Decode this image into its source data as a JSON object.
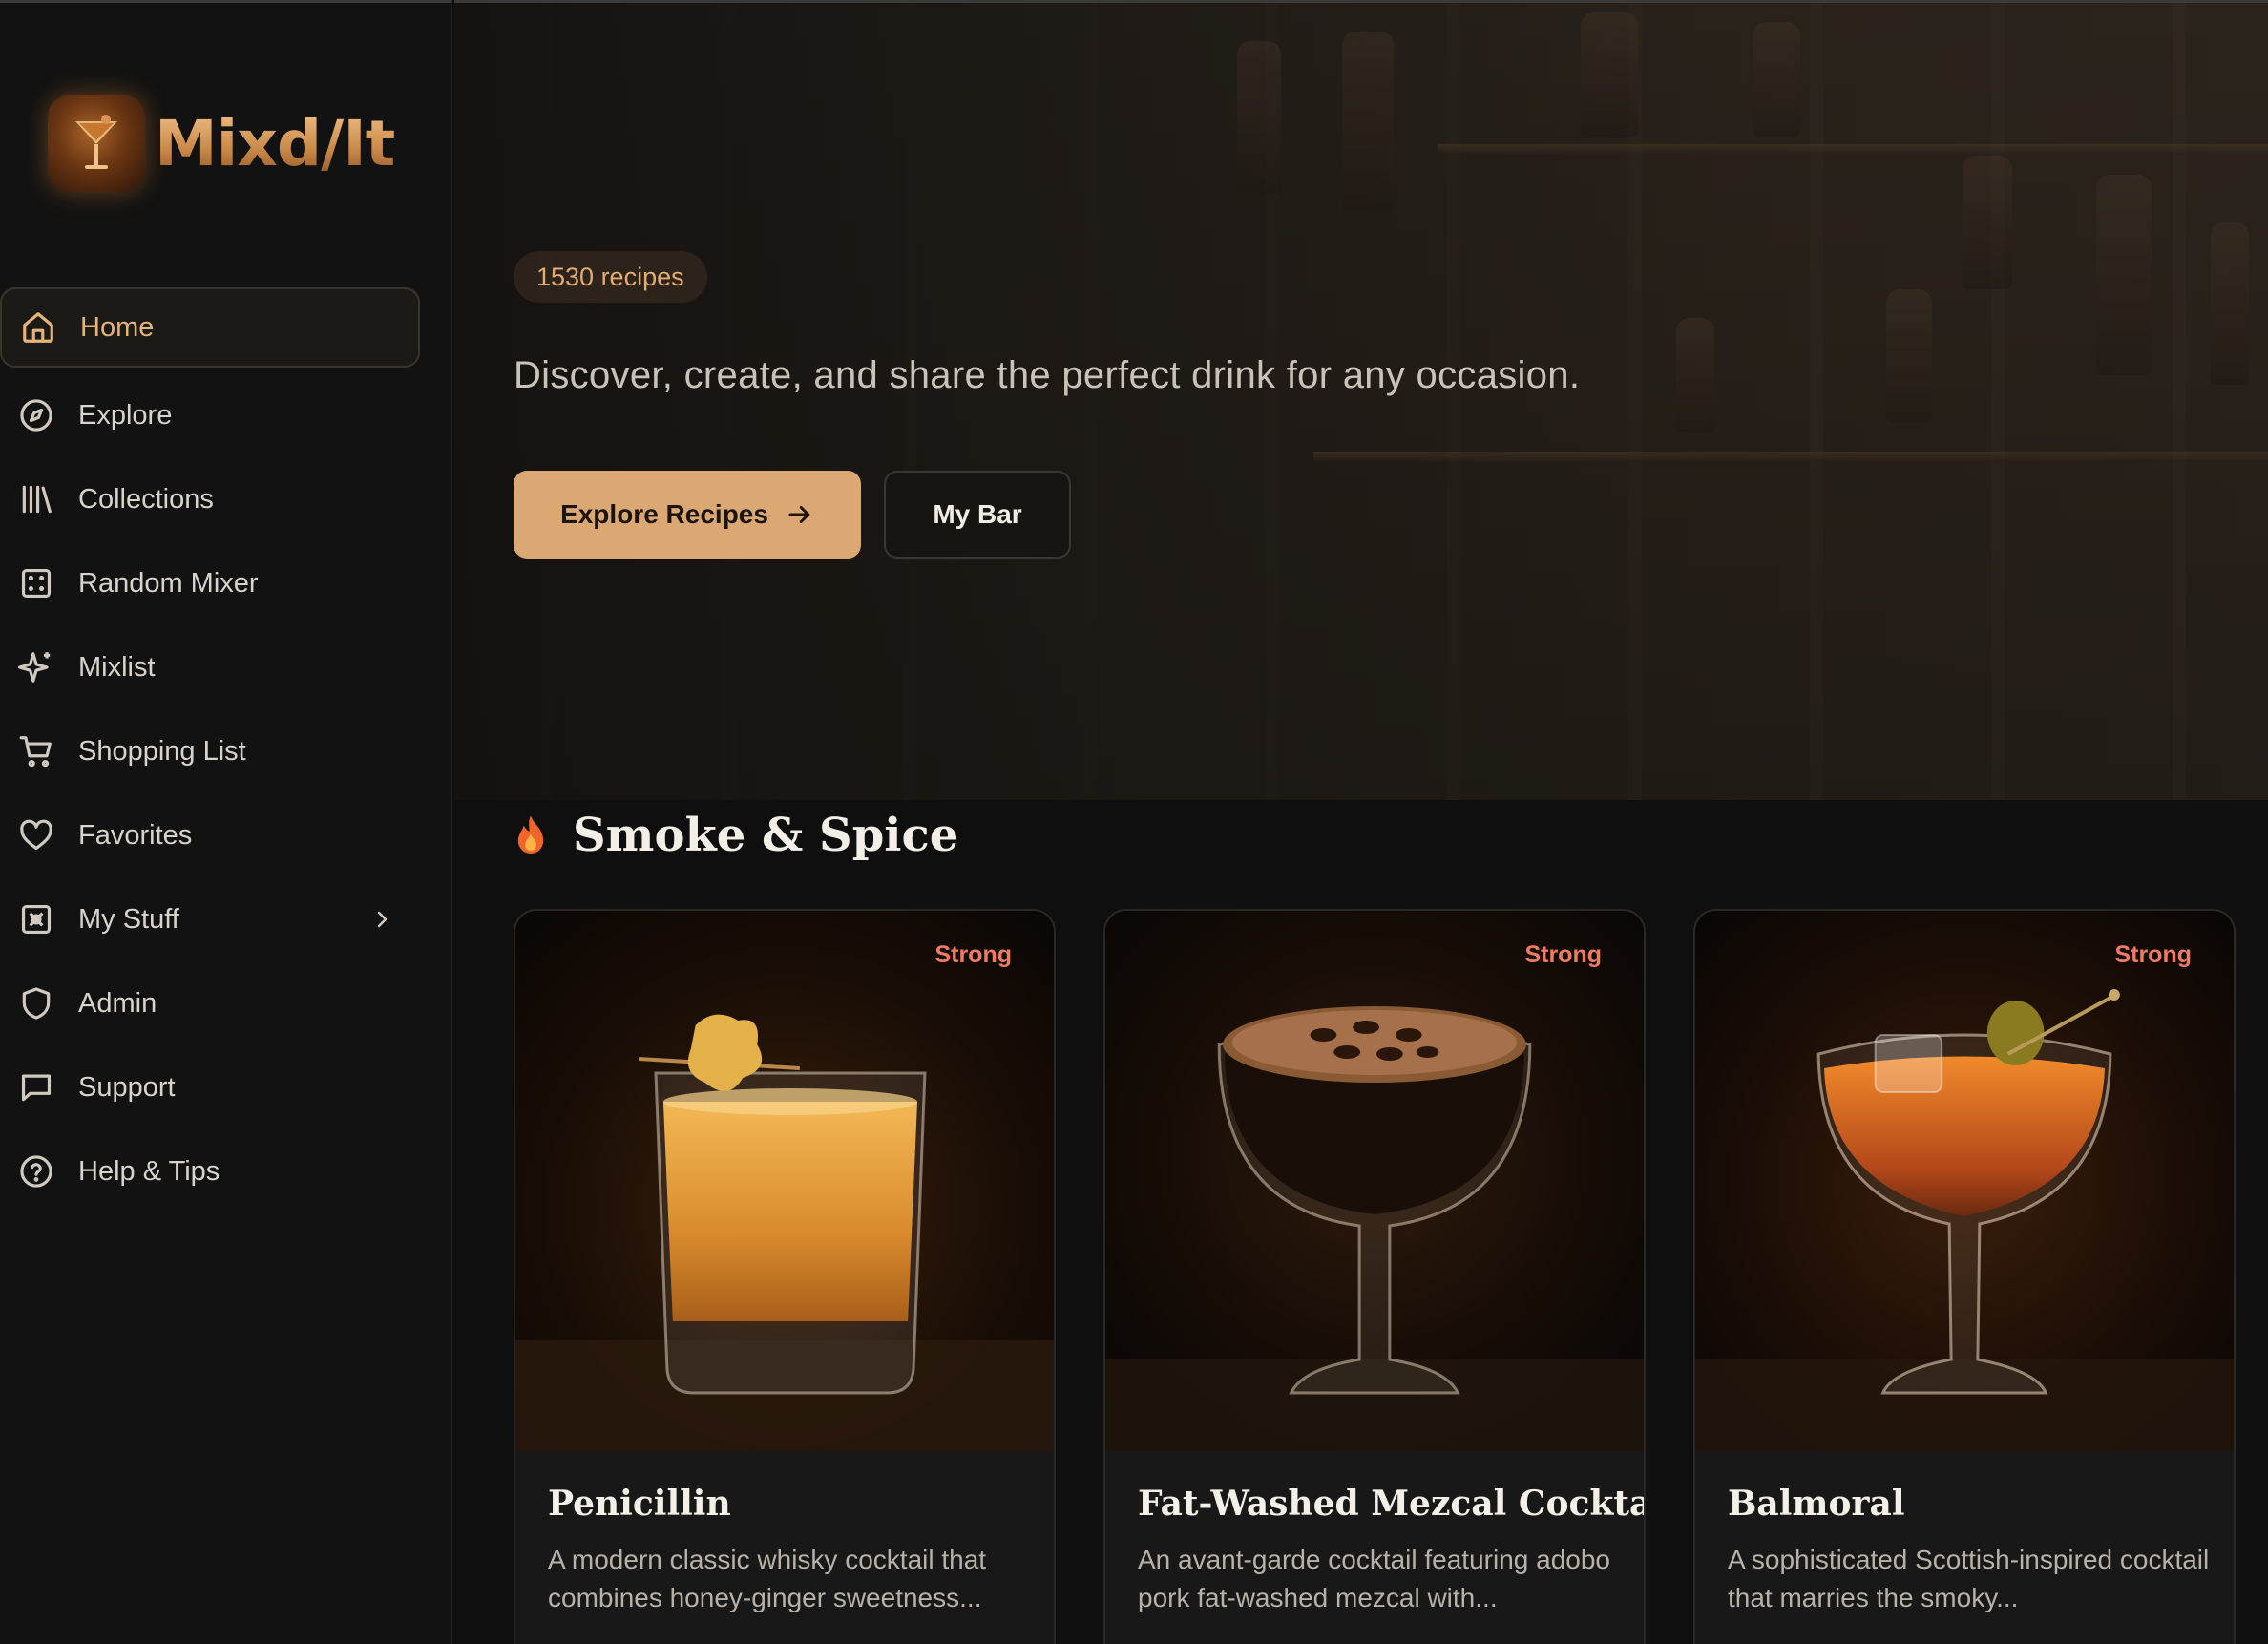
{
  "brand": {
    "name": "Mixd/It"
  },
  "sidebar": {
    "items": [
      {
        "label": "Home",
        "icon": "home-icon",
        "active": true
      },
      {
        "label": "Explore",
        "icon": "compass-icon"
      },
      {
        "label": "Collections",
        "icon": "library-icon"
      },
      {
        "label": "Random Mixer",
        "icon": "dice-icon"
      },
      {
        "label": "Mixlist",
        "icon": "sparkles-icon"
      },
      {
        "label": "Shopping List",
        "icon": "cart-icon"
      },
      {
        "label": "Favorites",
        "icon": "heart-icon"
      },
      {
        "label": "My Stuff",
        "icon": "box-icon",
        "has_submenu": true
      },
      {
        "label": "Admin",
        "icon": "shield-icon"
      },
      {
        "label": "Support",
        "icon": "chat-icon"
      },
      {
        "label": "Help & Tips",
        "icon": "help-circle-icon"
      }
    ]
  },
  "hero": {
    "recipe_count": "1530 recipes",
    "tagline": "Discover, create, and share the perfect drink for any occasion.",
    "primary_button": "Explore Recipes",
    "secondary_button": "My Bar"
  },
  "section": {
    "title": "Smoke & Spice",
    "icon": "flame-icon",
    "cards": [
      {
        "title": "Penicillin",
        "strength": "Strong",
        "description": "A modern classic whisky cocktail that combines honey-ginger sweetness..."
      },
      {
        "title": "Fat-Washed Mezcal Cocktail",
        "strength": "Strong",
        "description": "An avant-garde cocktail featuring adobo pork fat-washed mezcal with..."
      },
      {
        "title": "Balmoral",
        "strength": "Strong",
        "description": "A sophisticated Scottish-inspired cocktail that marries the smoky..."
      }
    ]
  },
  "colors": {
    "accent": "#dba874",
    "strength": "#f07a62",
    "background": "#0f0f0f"
  }
}
